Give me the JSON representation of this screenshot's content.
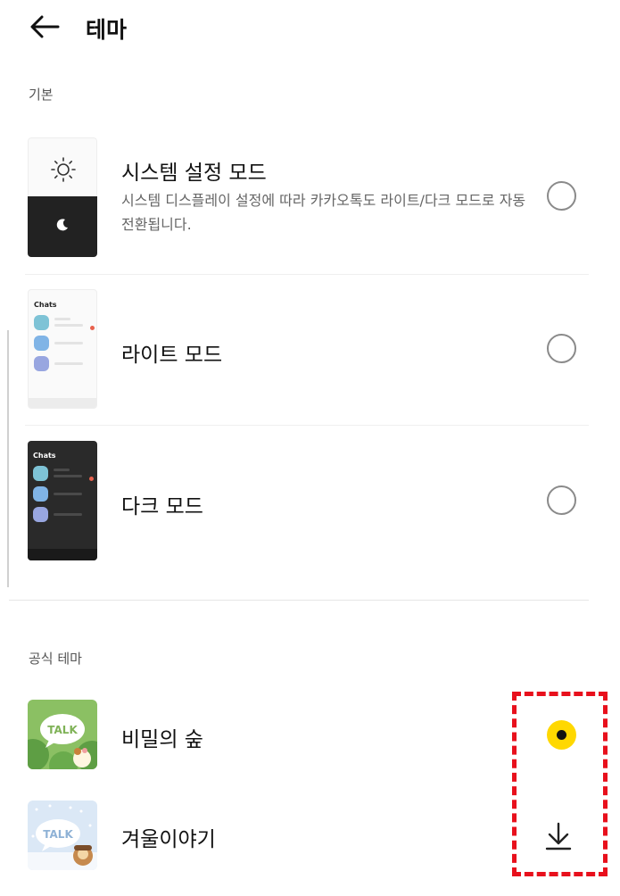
{
  "header": {
    "title": "테마"
  },
  "sections": {
    "basic": "기본",
    "official": "공식 테마"
  },
  "modes": [
    {
      "title": "시스템 설정 모드",
      "description": "시스템 디스플레이 설정에 따라 카카오톡도 라이트/다크 모드로 자동 전환됩니다.",
      "selected": false
    },
    {
      "title": "라이트 모드",
      "preview_label": "Chats",
      "selected": false
    },
    {
      "title": "다크 모드",
      "preview_label": "Chats",
      "selected": false
    }
  ],
  "themes": [
    {
      "title": "비밀의 숲",
      "thumb_text": "TALK",
      "state": "selected"
    },
    {
      "title": "겨울이야기",
      "thumb_text": "TALK",
      "state": "download"
    }
  ],
  "colors": {
    "accent_selected": "#ffd800",
    "highlight": "#e8101c",
    "dark_thumb": "#222222",
    "light_thumb": "#fafafa"
  },
  "icons": {
    "back": "arrow-left-icon",
    "sun": "sun-icon",
    "moon": "moon-icon",
    "download": "download-icon"
  }
}
